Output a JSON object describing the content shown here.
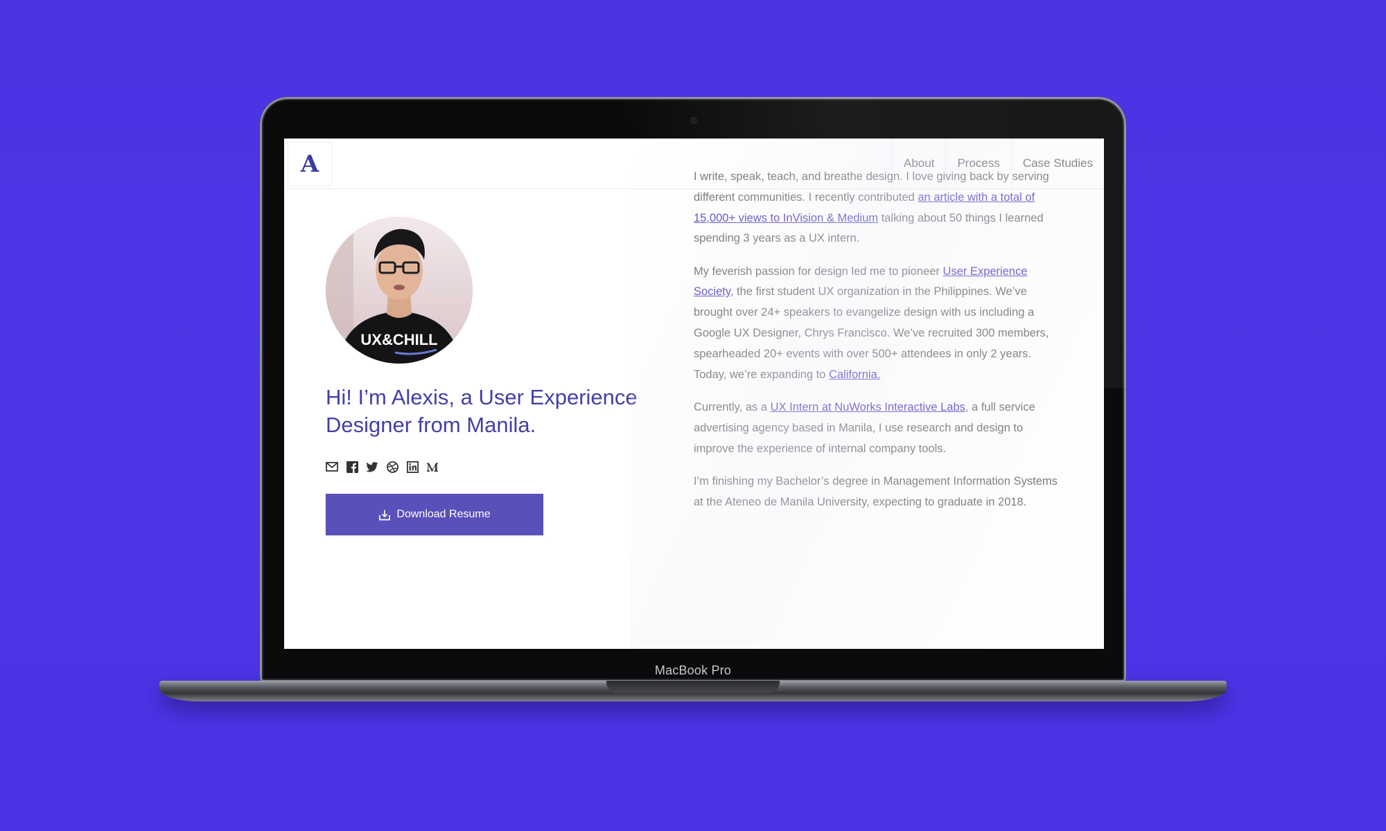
{
  "device": {
    "label": "MacBook Pro"
  },
  "nav": {
    "logo": "A",
    "links": [
      "About",
      "Process",
      "Case Studies"
    ]
  },
  "profile": {
    "avatar_shirt_text": "UX&CHILL",
    "heading": "Hi! I’m Alexis, a User Experience Designer from Manila.",
    "social_icons": [
      "mail-icon",
      "facebook-icon",
      "twitter-icon",
      "dribbble-icon",
      "linkedin-icon",
      "medium-icon"
    ],
    "download_label": "Download Resume"
  },
  "bio": {
    "p1": {
      "a": "I write, speak, teach, and breathe design. I love giving back by serving different communities. I recently contributed ",
      "link": "an article with a total of 15,000+ views to InVision & Medium",
      "b": " talking about 50 things I learned spending 3 years as a UX intern."
    },
    "p2": {
      "a": "My feverish passion for design led me to pioneer ",
      "link1": "User Experience Society",
      "b": ", the first student UX organization in the Philippines. We’ve brought over 24+ speakers to evangelize design with us including a Google UX Designer, Chrys Francisco. We’ve recruited 300 members, spearheaded 20+ events with over 500+ attendees in only 2 years. Today, we’re expanding to ",
      "link2": "California."
    },
    "p3": {
      "a": "Currently, as a ",
      "link": "UX Intern at NuWorks Interactive Labs",
      "b": ", a full service advertising agency based in Manila, I use research and design to improve the experience of internal company tools."
    },
    "p4": "I’m finishing my Bachelor’s degree in Management Information Systems at the Ateneo de Manila University, expecting to graduate in 2018."
  },
  "colors": {
    "background": "#4a34e2",
    "accent": "#433fa8",
    "button": "#5a50b9",
    "link": "#4b3fc0"
  }
}
